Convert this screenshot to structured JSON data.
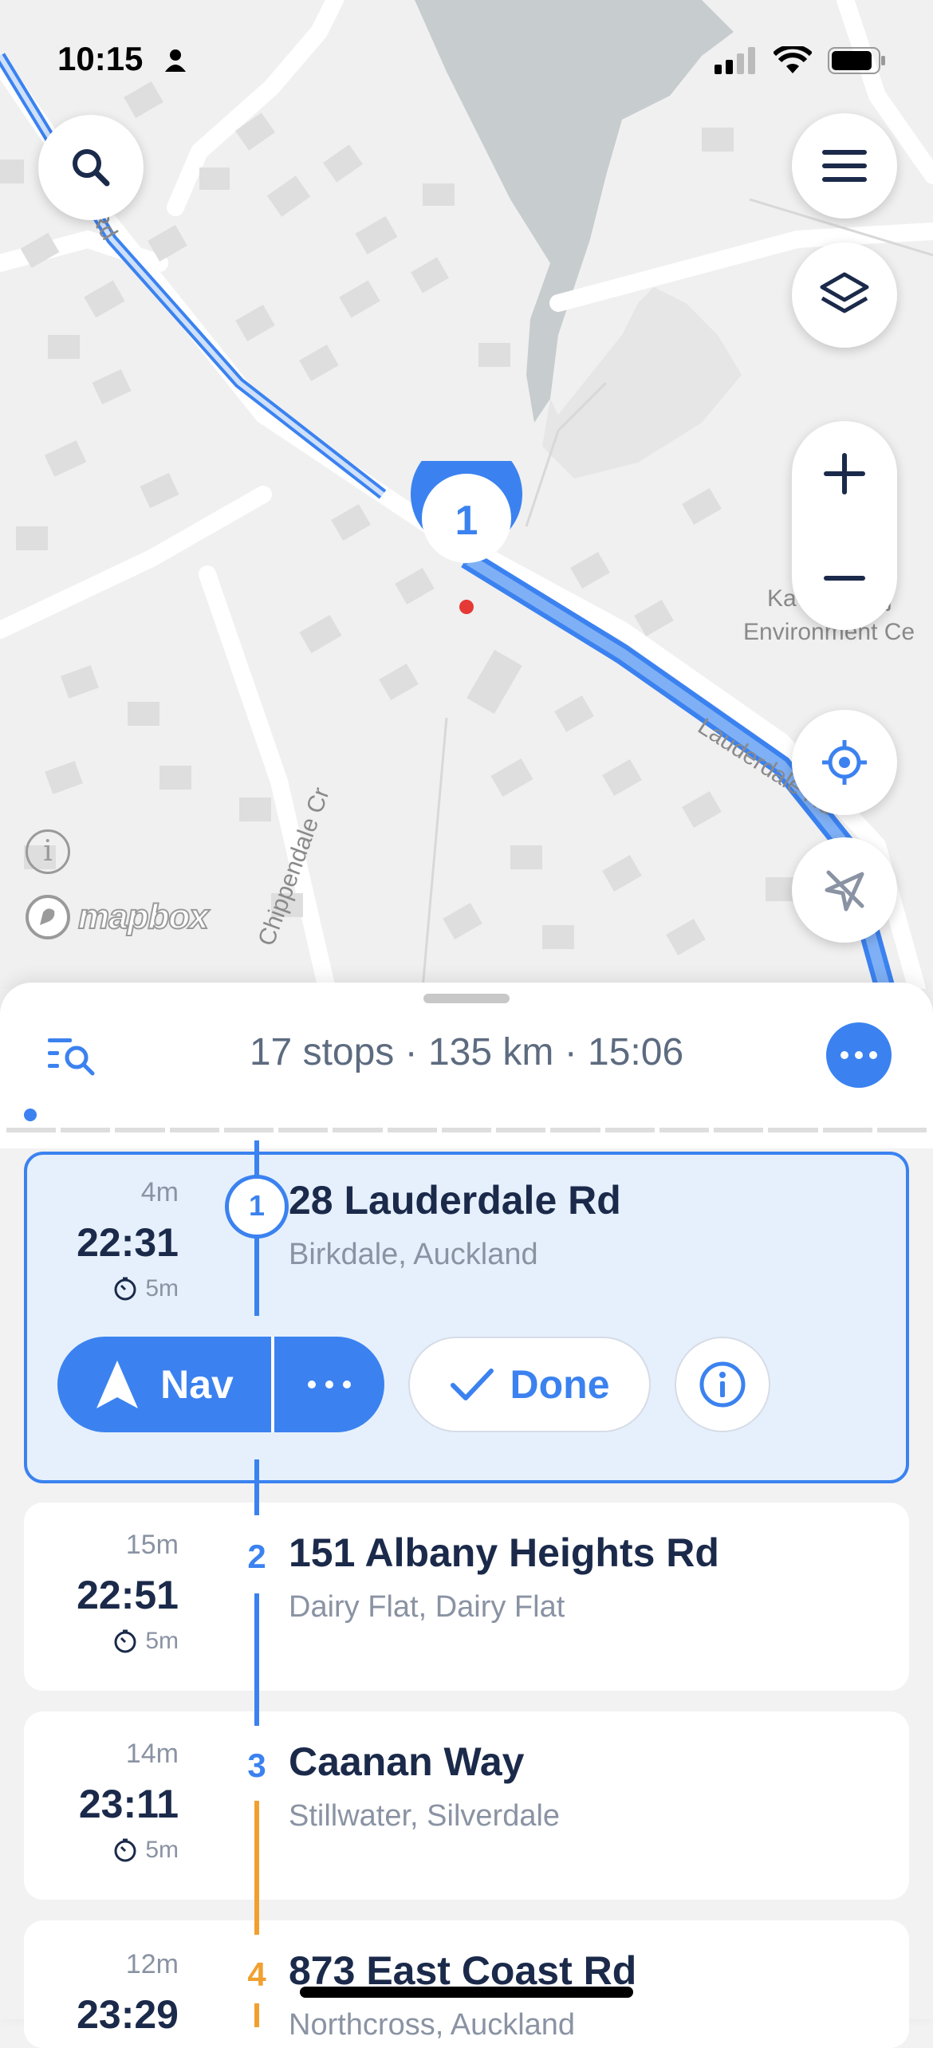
{
  "status_bar": {
    "time": "10:15"
  },
  "map": {
    "street_labels": [
      "Rd",
      "Lauderdale Rd",
      "Chippendale Cr"
    ],
    "poi_label_line1": "Ka        Proj",
    "poi_label_line2": "Environment Ce",
    "marker_number": "1",
    "attribution": "mapbox",
    "info_symbol": "i",
    "icons": [
      "search-icon",
      "menu-icon",
      "layers-icon",
      "plus-icon",
      "minus-icon",
      "locate-icon",
      "navigation-off-icon"
    ]
  },
  "sheet": {
    "summary": "17 stops · 135 km · 15:06",
    "progress_segments": 17,
    "stops": [
      {
        "duration": "4m",
        "time": "22:31",
        "wait": "5m",
        "number": "1",
        "address": "28 Lauderdale Rd",
        "area": "Birkdale, Auckland"
      },
      {
        "duration": "15m",
        "time": "22:51",
        "wait": "5m",
        "number": "2",
        "address": "151 Albany Heights Rd",
        "area": "Dairy Flat, Dairy Flat"
      },
      {
        "duration": "14m",
        "time": "23:11",
        "wait": "5m",
        "number": "3",
        "address": "Caanan Way",
        "area": "Stillwater, Silverdale"
      },
      {
        "duration": "12m",
        "time": "23:29",
        "wait": "",
        "number": "4",
        "address": "873 East Coast Rd",
        "area": "Northcross, Auckland"
      }
    ],
    "actions": {
      "nav_label": "Nav",
      "done_label": "Done"
    },
    "colors": {
      "accent": "#3b82f0",
      "orange": "#f0a030",
      "active_bg": "#e6f0fc"
    }
  }
}
